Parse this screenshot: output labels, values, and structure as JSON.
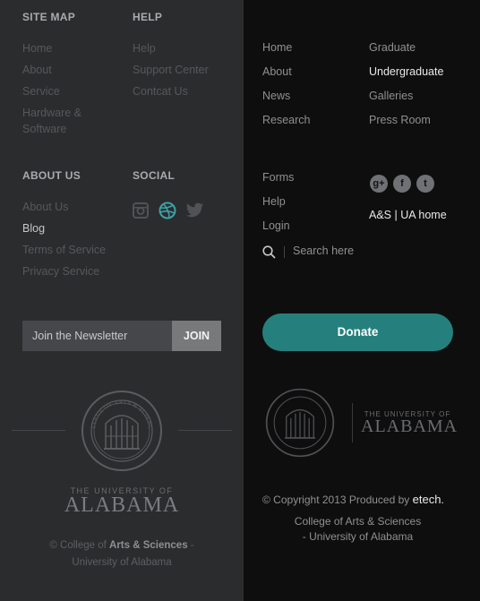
{
  "sitemap": {
    "heading": "SITE MAP",
    "items": [
      "Home",
      "About",
      "Service",
      "Hardware & Software"
    ]
  },
  "help": {
    "heading": "HELP",
    "items": [
      "Help",
      "Support Center",
      "Contcat Us"
    ]
  },
  "aboutus": {
    "heading": "ABOUT US",
    "items": [
      "About Us",
      "Blog",
      "Terms of Service",
      "Privacy Service"
    ]
  },
  "social": {
    "heading": "SOCIAL",
    "icons": [
      "instagram-icon",
      "dribbble-icon",
      "twitter-icon"
    ]
  },
  "newsletter": {
    "placeholder": "Join the Newsletter",
    "button": "JOIN"
  },
  "left_footer": {
    "seal_text": "COLLEGE OF ARTS & SCIENCES",
    "ua_small": "THE UNIVERSITY OF",
    "ua_big": "ALABAMA",
    "copy_prefix": "© College of",
    "copy_bold": "Arts & Sciences",
    "copy_dash": "-",
    "copy_line2": "University of Alabama"
  },
  "right_nav": {
    "col1": [
      "Home",
      "About",
      "News",
      "Research"
    ],
    "col2": [
      "Graduate",
      "Undergraduate",
      "Galleries",
      "Press Room"
    ],
    "col3": [
      "Forms",
      "Help",
      "Login"
    ]
  },
  "right_social": {
    "icons": [
      "google-plus-icon",
      "facebook-icon",
      "twitter-icon"
    ],
    "glyphs": [
      "g+",
      "f",
      "t"
    ]
  },
  "right_links": {
    "as": "A&S",
    "sep": "|",
    "ua": "UA home"
  },
  "search": {
    "placeholder": "Search here"
  },
  "donate": {
    "label": "Donate"
  },
  "right_footer": {
    "ua_small": "THE UNIVERSITY OF",
    "ua_big": "ALABAMA",
    "copyright": "© Copyright 2013  Produced by",
    "brand": "etech",
    "brand_dot": ".",
    "college_line1": "College of Arts & Sciences",
    "college_line2": "- University of Alabama"
  },
  "colors": {
    "accent": "#25807d",
    "left_bg": "#2b2c2e",
    "right_bg": "#0e0e0f"
  }
}
